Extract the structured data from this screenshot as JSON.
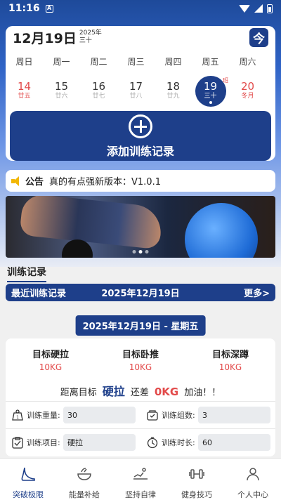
{
  "status_bar": {
    "time": "11:16",
    "notif_letter": "A",
    "battery_icon": "battery-icon",
    "wifi_icon": "wifi-icon"
  },
  "calendar": {
    "date_label": "12月19日",
    "year": "2025年",
    "lunar_day": "三十",
    "today_button": "今",
    "weekdays": [
      "周日",
      "周一",
      "周二",
      "周三",
      "周四",
      "周五",
      "周六"
    ],
    "days": [
      {
        "num": "14",
        "lunar": "廿五"
      },
      {
        "num": "15",
        "lunar": "廿六"
      },
      {
        "num": "16",
        "lunar": "廿七"
      },
      {
        "num": "17",
        "lunar": "廿八"
      },
      {
        "num": "18",
        "lunar": "廿九"
      },
      {
        "num": "19",
        "lunar": "三十",
        "badge": "班"
      },
      {
        "num": "20",
        "lunar": "冬月"
      }
    ],
    "accent_color": "#1e3f8a",
    "holiday_color": "#e24a4a"
  },
  "add_record": {
    "label": "添加训练记录"
  },
  "notice": {
    "label": "公告",
    "text": "真的有点强新版本：V1.0.1"
  },
  "section": {
    "title": "训练记录"
  },
  "recent": {
    "left": "最近训练记录",
    "date": "2025年12月19日",
    "more": "更多>"
  },
  "record": {
    "date_title": "2025年12月19日 - 星期五",
    "targets": [
      {
        "title": "目标硬拉",
        "value": "10KG"
      },
      {
        "title": "目标卧推",
        "value": "10KG"
      },
      {
        "title": "目标深蹲",
        "value": "10KG"
      }
    ],
    "gap": {
      "prefix": "距离目标",
      "exercise": "硬拉",
      "mid": "还差",
      "amount": "0KG",
      "suffix": "加油！！"
    },
    "fields": {
      "weight_label": "训练重量:",
      "weight_value": "30",
      "sets_label": "训练组数:",
      "sets_value": "3",
      "item_label": "训练项目:",
      "item_value": "硬拉",
      "duration_label": "训练时长:",
      "duration_value": "60"
    }
  },
  "tabs": [
    {
      "label": "突破极限",
      "icon": "foot-icon"
    },
    {
      "label": "能量补给",
      "icon": "bowl-icon"
    },
    {
      "label": "坚持自律",
      "icon": "running-icon"
    },
    {
      "label": "健身技巧",
      "icon": "dumbbell-icon"
    },
    {
      "label": "个人中心",
      "icon": "person-icon"
    }
  ],
  "banner": {
    "active_dot": 2,
    "dot_count": 3
  }
}
